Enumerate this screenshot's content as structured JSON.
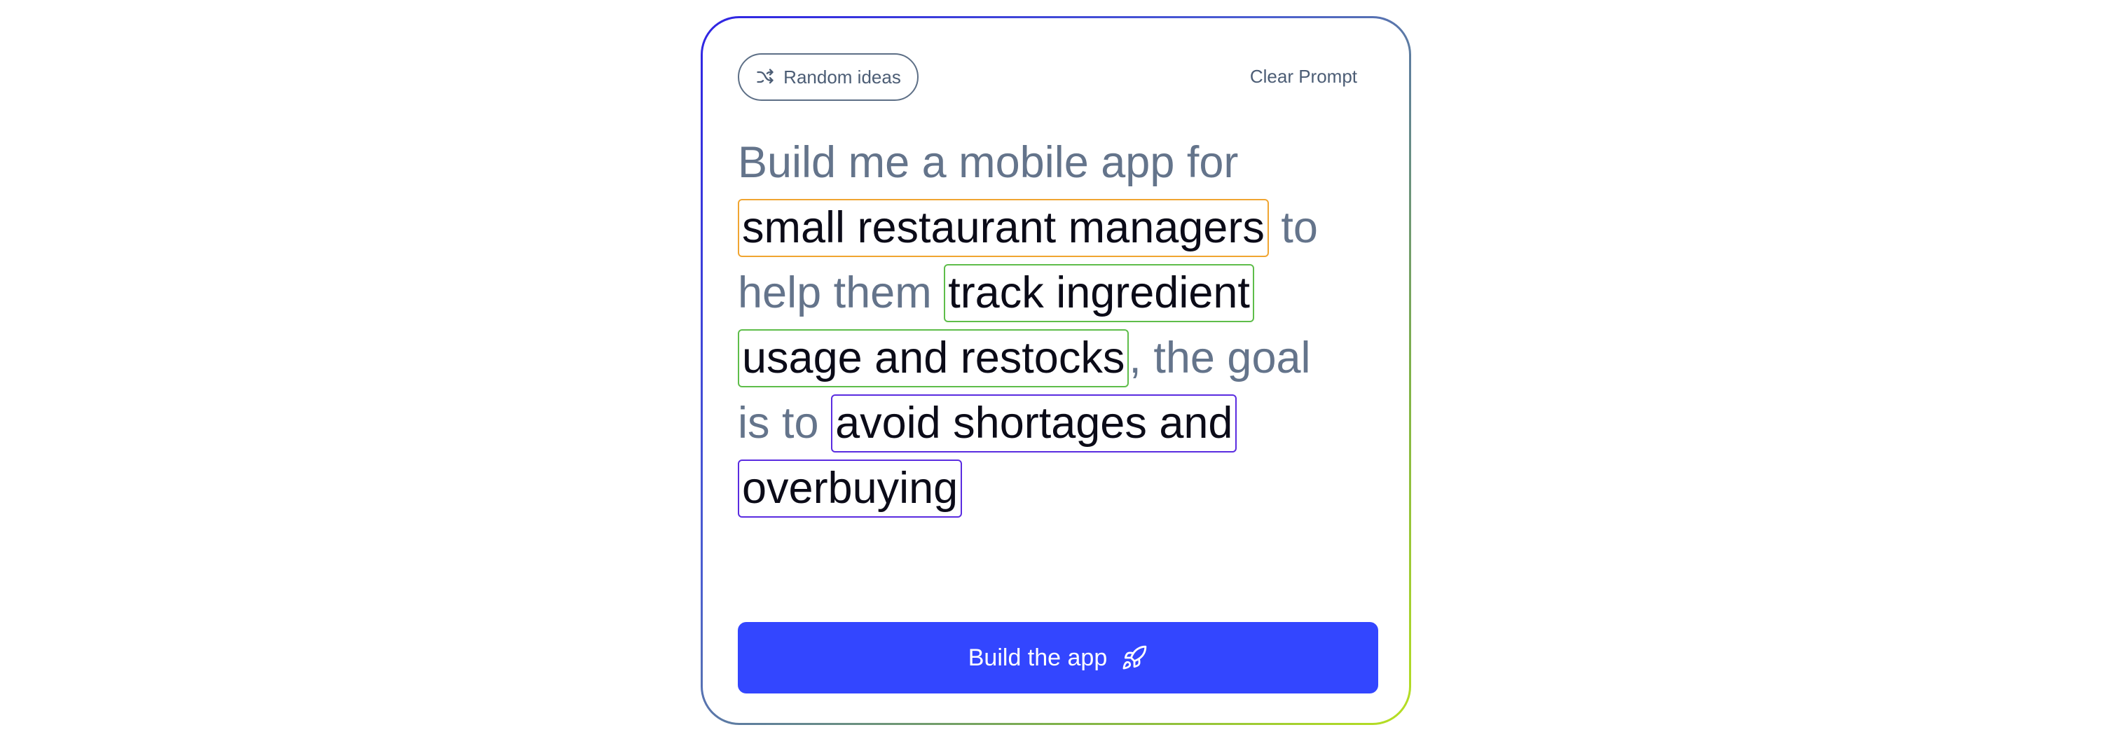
{
  "toolbar": {
    "random_label": "Random ideas",
    "random_icon": "shuffle-icon",
    "clear_label": "Clear Prompt"
  },
  "prompt": {
    "intro": "Build me a mobile app for",
    "audience": "small restaurant managers",
    "connector_help": "to help them",
    "task": "track ingredient usage and restocks",
    "connector_goal": ", the goal is to",
    "goal": "avoid shortages and overbuying"
  },
  "action": {
    "build_label": "Build the app",
    "build_icon": "rocket-icon",
    "color": "#3346ff"
  },
  "colors": {
    "audience_border": "#f0a531",
    "task_border": "#5ebd4a",
    "goal_border": "#5a2ce0",
    "placeholder_text": "#64748b"
  }
}
